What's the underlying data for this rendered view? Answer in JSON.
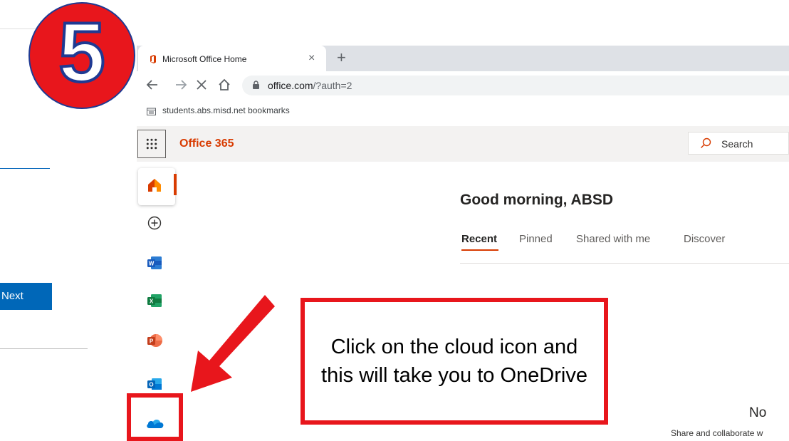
{
  "step_number": "5",
  "left_page": {
    "next_button": "Next"
  },
  "browser": {
    "tab_title": "Microsoft Office Home",
    "tab_close": "×",
    "new_tab": "+",
    "url_host": "office.com",
    "url_path": "/?auth=2",
    "bookmark": "students.abs.misd.net bookmarks"
  },
  "office": {
    "brand": "Office 365",
    "search_placeholder": "Search",
    "greeting": "Good morning, ABSD",
    "tabs": [
      {
        "label": "Recent",
        "active": true
      },
      {
        "label": "Pinned"
      },
      {
        "label": "Shared with me"
      },
      {
        "label": "Discover"
      }
    ],
    "empty_title": "No",
    "empty_sub": "Share and collaborate w",
    "rail": [
      "home-icon",
      "create-icon",
      "word-icon",
      "excel-icon",
      "powerpoint-icon",
      "outlook-icon",
      "onedrive-icon"
    ]
  },
  "annotation": {
    "callout_text": "Click on the cloud icon and this will take you to OneDrive",
    "colors": {
      "red": "#e8161c",
      "outline": "#1f3a93",
      "accent": "#d83b01"
    }
  }
}
